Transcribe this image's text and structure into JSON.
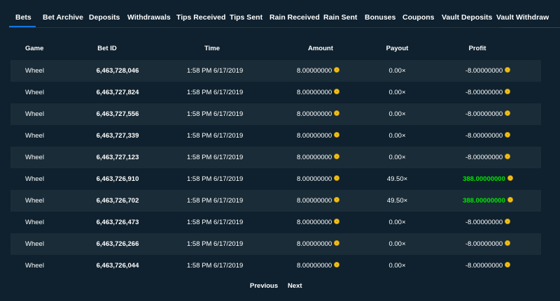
{
  "tabs": [
    {
      "label": "Bets",
      "active": true
    },
    {
      "label": "Bet Archive",
      "active": false
    },
    {
      "label": "Deposits",
      "active": false
    },
    {
      "label": "Withdrawals",
      "active": false
    },
    {
      "label": "Tips Received",
      "active": false
    },
    {
      "label": "Tips Sent",
      "active": false
    },
    {
      "label": "Rain Received",
      "active": false
    },
    {
      "label": "Rain Sent",
      "active": false
    },
    {
      "label": "Bonuses",
      "active": false
    },
    {
      "label": "Coupons",
      "active": false
    },
    {
      "label": "Vault Deposits",
      "active": false
    },
    {
      "label": "Vault Withdraw",
      "active": false
    }
  ],
  "table": {
    "headers": {
      "game": "Game",
      "bet_id": "Bet ID",
      "time": "Time",
      "amount": "Amount",
      "payout": "Payout",
      "profit": "Profit"
    },
    "rows": [
      {
        "game": "Wheel",
        "bet_id": "6,463,728,046",
        "time": "1:58 PM 6/17/2019",
        "amount": "8.00000000",
        "payout": "0.00×",
        "profit": "-8.00000000",
        "win": false
      },
      {
        "game": "Wheel",
        "bet_id": "6,463,727,824",
        "time": "1:58 PM 6/17/2019",
        "amount": "8.00000000",
        "payout": "0.00×",
        "profit": "-8.00000000",
        "win": false
      },
      {
        "game": "Wheel",
        "bet_id": "6,463,727,556",
        "time": "1:58 PM 6/17/2019",
        "amount": "8.00000000",
        "payout": "0.00×",
        "profit": "-8.00000000",
        "win": false
      },
      {
        "game": "Wheel",
        "bet_id": "6,463,727,339",
        "time": "1:58 PM 6/17/2019",
        "amount": "8.00000000",
        "payout": "0.00×",
        "profit": "-8.00000000",
        "win": false
      },
      {
        "game": "Wheel",
        "bet_id": "6,463,727,123",
        "time": "1:58 PM 6/17/2019",
        "amount": "8.00000000",
        "payout": "0.00×",
        "profit": "-8.00000000",
        "win": false
      },
      {
        "game": "Wheel",
        "bet_id": "6,463,726,910",
        "time": "1:58 PM 6/17/2019",
        "amount": "8.00000000",
        "payout": "49.50×",
        "profit": "388.00000000",
        "win": true
      },
      {
        "game": "Wheel",
        "bet_id": "6,463,726,702",
        "time": "1:58 PM 6/17/2019",
        "amount": "8.00000000",
        "payout": "49.50×",
        "profit": "388.00000000",
        "win": true
      },
      {
        "game": "Wheel",
        "bet_id": "6,463,726,473",
        "time": "1:58 PM 6/17/2019",
        "amount": "8.00000000",
        "payout": "0.00×",
        "profit": "-8.00000000",
        "win": false
      },
      {
        "game": "Wheel",
        "bet_id": "6,463,726,266",
        "time": "1:58 PM 6/17/2019",
        "amount": "8.00000000",
        "payout": "0.00×",
        "profit": "-8.00000000",
        "win": false
      },
      {
        "game": "Wheel",
        "bet_id": "6,463,726,044",
        "time": "1:58 PM 6/17/2019",
        "amount": "8.00000000",
        "payout": "0.00×",
        "profit": "-8.00000000",
        "win": false
      }
    ]
  },
  "pagination": {
    "previous": "Previous",
    "next": "Next"
  },
  "icons": {
    "currency": "coin-icon"
  },
  "colors": {
    "background": "#0f212e",
    "row_alt": "#1a2c38",
    "active_tab_underline": "#1475e1",
    "win_profit": "#00e701",
    "coin": "#f5c51b"
  }
}
